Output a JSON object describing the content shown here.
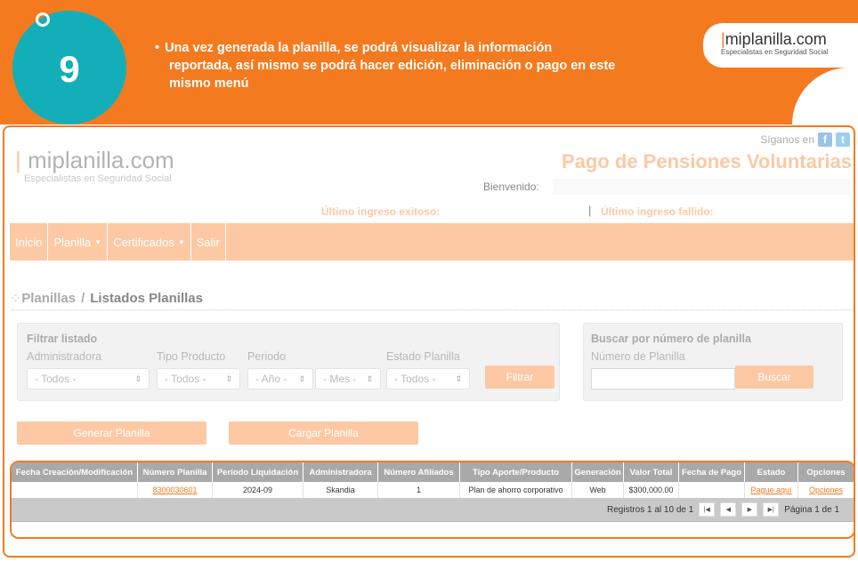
{
  "banner": {
    "step_number": "9",
    "instruction_lines": [
      "Una vez generada la planilla, se podrá visualizar la información",
      "reportada, así mismo se podrá hacer edición, eliminación o pago en este",
      "mismo menú"
    ],
    "logo_brand": "miplanilla.com",
    "logo_tagline": "Especialistas en Seguridad Social",
    "accent_color": "#f47a20",
    "circle_color": "#14aeb8"
  },
  "app": {
    "follow_label": "Síganos en",
    "social_icons": [
      "facebook-icon",
      "twitter-icon"
    ],
    "logo_brand": "miplanilla.com",
    "logo_tagline": "Especialistas en Seguridad Social",
    "title": "Pago de Pensiones Voluntarias",
    "welcome_label": "Bienvenido:",
    "last_success_label": "Último ingreso exitoso:",
    "last_fail_label": "Último ingreso fallido:",
    "nav": [
      {
        "label": "Inicio",
        "has_caret": false
      },
      {
        "label": "Planilla",
        "has_caret": true
      },
      {
        "label": "Certificados",
        "has_caret": true
      },
      {
        "label": "Salir",
        "has_caret": false
      }
    ],
    "breadcrumb": {
      "parent": "Planillas",
      "separator": "/",
      "current": "Listados Planillas"
    },
    "filter": {
      "title": "Filtrar listado",
      "administradora_label": "Administradora",
      "administradora_value": "- Todos -",
      "tipo_producto_label": "Tipo Producto",
      "tipo_producto_value": "- Todos -",
      "periodo_label": "Periodo",
      "anio_value": "- Año -",
      "mes_value": "- Mes -",
      "estado_label": "Estado Planilla",
      "estado_value": "- Todos -",
      "filter_button": "Filtrar"
    },
    "search": {
      "title": "Buscar por número de planilla",
      "field_label": "Número de Planilla",
      "input_value": "",
      "button": "Buscar"
    },
    "actions": {
      "generate_button": "Generar Planilla",
      "upload_button": "Cargar Planilla"
    },
    "table": {
      "headers": [
        "Fecha Creación/Modificación",
        "Número Planilla",
        "Período Liquidación",
        "Administradora",
        "Número Afiliados",
        "Tipo Aporte/Producto",
        "Generación",
        "Valor Total",
        "Fecha de Pago",
        "Estado",
        "Opciones"
      ],
      "rows": [
        [
          "",
          "8300030601",
          "2024-09",
          "Skandia",
          "1",
          "Plan de ahorro corporativo",
          "Web",
          "$300,000.00",
          "",
          "Pague aquí",
          "Opciones"
        ]
      ],
      "pager_text": "Registros 1 al 10 de 1",
      "page_text": "Página 1 de 1"
    }
  }
}
